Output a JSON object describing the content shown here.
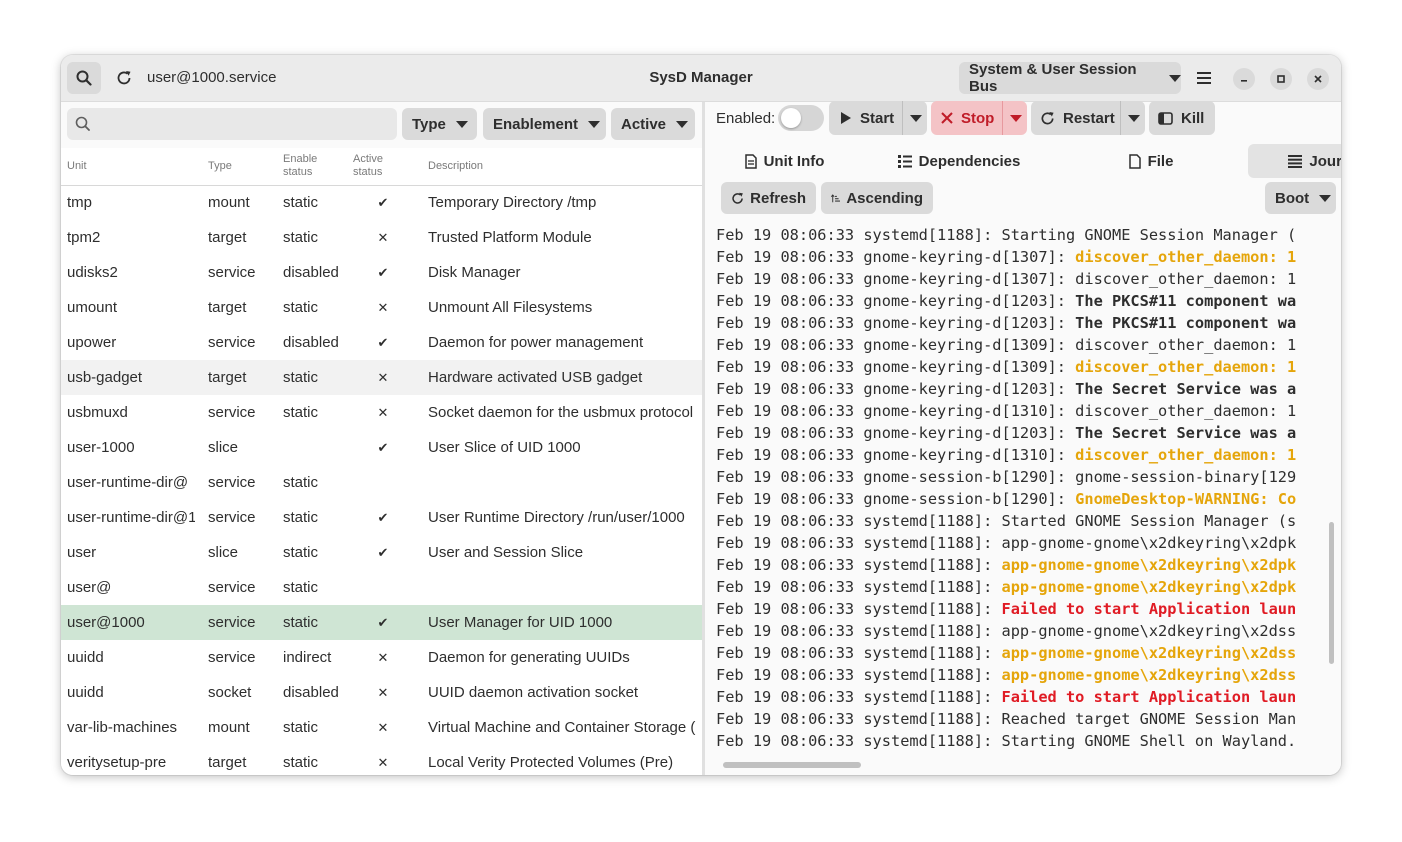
{
  "header": {
    "current_unit": "user@1000.service",
    "title": "SysD Manager",
    "bus_selector": "System & User Session Bus"
  },
  "filters": {
    "search_placeholder": "",
    "type_label": "Type",
    "enablement_label": "Enablement",
    "active_label": "Active"
  },
  "columns": {
    "unit": "Unit",
    "type": "Type",
    "enable_1": "Enable",
    "enable_2": "status",
    "active_1": "Active",
    "active_2": "status",
    "description": "Description"
  },
  "units": [
    {
      "unit": "tmp",
      "type": "mount",
      "enable": "static",
      "active": "✔",
      "desc": "Temporary Directory /tmp"
    },
    {
      "unit": "tpm2",
      "type": "target",
      "enable": "static",
      "active": "✕",
      "desc": "Trusted Platform Module"
    },
    {
      "unit": "udisks2",
      "type": "service",
      "enable": "disabled",
      "active": "✔",
      "desc": "Disk Manager"
    },
    {
      "unit": "umount",
      "type": "target",
      "enable": "static",
      "active": "✕",
      "desc": "Unmount All Filesystems"
    },
    {
      "unit": "upower",
      "type": "service",
      "enable": "disabled",
      "active": "✔",
      "desc": "Daemon for power management"
    },
    {
      "unit": "usb-gadget",
      "type": "target",
      "enable": "static",
      "active": "✕",
      "desc": "Hardware activated USB gadget"
    },
    {
      "unit": "usbmuxd",
      "type": "service",
      "enable": "static",
      "active": "✕",
      "desc": "Socket daemon for the usbmux protocol u"
    },
    {
      "unit": "user-1000",
      "type": "slice",
      "enable": "",
      "active": "✔",
      "desc": "User Slice of UID 1000"
    },
    {
      "unit": "user-runtime-dir@",
      "type": "service",
      "enable": "static",
      "active": "",
      "desc": ""
    },
    {
      "unit": "user-runtime-dir@1",
      "type": "service",
      "enable": "static",
      "active": "✔",
      "desc": "User Runtime Directory /run/user/1000"
    },
    {
      "unit": "user",
      "type": "slice",
      "enable": "static",
      "active": "✔",
      "desc": "User and Session Slice"
    },
    {
      "unit": "user@",
      "type": "service",
      "enable": "static",
      "active": "",
      "desc": ""
    },
    {
      "unit": "user@1000",
      "type": "service",
      "enable": "static",
      "active": "✔",
      "desc": "User Manager for UID 1000"
    },
    {
      "unit": "uuidd",
      "type": "service",
      "enable": "indirect",
      "active": "✕",
      "desc": "Daemon for generating UUIDs"
    },
    {
      "unit": "uuidd",
      "type": "socket",
      "enable": "disabled",
      "active": "✕",
      "desc": "UUID daemon activation socket"
    },
    {
      "unit": "var-lib-machines",
      "type": "mount",
      "enable": "static",
      "active": "✕",
      "desc": "Virtual Machine and Container Storage (C"
    },
    {
      "unit": "veritysetup-pre",
      "type": "target",
      "enable": "static",
      "active": "✕",
      "desc": "Local Verity Protected Volumes (Pre)"
    }
  ],
  "toolbar": {
    "enabled_label": "Enabled:",
    "start": "Start",
    "stop": "Stop",
    "restart": "Restart",
    "kill": "Kill"
  },
  "tabs": {
    "unit_info": "Unit Info",
    "dependencies": "Dependencies",
    "file": "File",
    "journal": "Journal"
  },
  "journal_bar": {
    "refresh": "Refresh",
    "ascending": "Ascending",
    "boot": "Boot"
  },
  "journal": [
    {
      "prefix": "Feb 19 08:06:33 systemd[1188]: ",
      "msg": "Starting GNOME Session Manager (",
      "style": "n"
    },
    {
      "prefix": "Feb 19 08:06:33 gnome-keyring-d[1307]: ",
      "msg": "discover_other_daemon: 1",
      "style": "w"
    },
    {
      "prefix": "Feb 19 08:06:33 gnome-keyring-d[1307]: ",
      "msg": "discover_other_daemon: 1",
      "style": "n"
    },
    {
      "prefix": "Feb 19 08:06:33 gnome-keyring-d[1203]: ",
      "msg": "The PKCS#11 component wa",
      "style": "b"
    },
    {
      "prefix": "Feb 19 08:06:33 gnome-keyring-d[1203]: ",
      "msg": "The PKCS#11 component wa",
      "style": "b"
    },
    {
      "prefix": "Feb 19 08:06:33 gnome-keyring-d[1309]: ",
      "msg": "discover_other_daemon: 1",
      "style": "n"
    },
    {
      "prefix": "Feb 19 08:06:33 gnome-keyring-d[1309]: ",
      "msg": "discover_other_daemon: 1",
      "style": "w"
    },
    {
      "prefix": "Feb 19 08:06:33 gnome-keyring-d[1203]: ",
      "msg": "The Secret Service was a",
      "style": "b"
    },
    {
      "prefix": "Feb 19 08:06:33 gnome-keyring-d[1310]: ",
      "msg": "discover_other_daemon: 1",
      "style": "n"
    },
    {
      "prefix": "Feb 19 08:06:33 gnome-keyring-d[1203]: ",
      "msg": "The Secret Service was a",
      "style": "b"
    },
    {
      "prefix": "Feb 19 08:06:33 gnome-keyring-d[1310]: ",
      "msg": "discover_other_daemon: 1",
      "style": "w"
    },
    {
      "prefix": "Feb 19 08:06:33 gnome-session-b[1290]: ",
      "msg": "gnome-session-binary[129",
      "style": "n"
    },
    {
      "prefix": "Feb 19 08:06:33 gnome-session-b[1290]: ",
      "msg": "GnomeDesktop-WARNING: Co",
      "style": "w"
    },
    {
      "prefix": "Feb 19 08:06:33 systemd[1188]: ",
      "msg": "Started GNOME Session Manager (s",
      "style": "n"
    },
    {
      "prefix": "Feb 19 08:06:33 systemd[1188]: ",
      "msg": "app-gnome-gnome\\x2dkeyring\\x2dpk",
      "style": "n"
    },
    {
      "prefix": "Feb 19 08:06:33 systemd[1188]: ",
      "msg": "app-gnome-gnome\\x2dkeyring\\x2dpk",
      "style": "w"
    },
    {
      "prefix": "Feb 19 08:06:33 systemd[1188]: ",
      "msg": "app-gnome-gnome\\x2dkeyring\\x2dpk",
      "style": "w"
    },
    {
      "prefix": "Feb 19 08:06:33 systemd[1188]: ",
      "msg": "Failed to start Application laun",
      "style": "e"
    },
    {
      "prefix": "Feb 19 08:06:33 systemd[1188]: ",
      "msg": "app-gnome-gnome\\x2dkeyring\\x2dss",
      "style": "n"
    },
    {
      "prefix": "Feb 19 08:06:33 systemd[1188]: ",
      "msg": "app-gnome-gnome\\x2dkeyring\\x2dss",
      "style": "w"
    },
    {
      "prefix": "Feb 19 08:06:33 systemd[1188]: ",
      "msg": "app-gnome-gnome\\x2dkeyring\\x2dss",
      "style": "w"
    },
    {
      "prefix": "Feb 19 08:06:33 systemd[1188]: ",
      "msg": "Failed to start Application laun",
      "style": "e"
    },
    {
      "prefix": "Feb 19 08:06:33 systemd[1188]: ",
      "msg": "Reached target GNOME Session Man",
      "style": "n"
    },
    {
      "prefix": "Feb 19 08:06:33 systemd[1188]: ",
      "msg": "Starting GNOME Shell on Wayland.",
      "style": "n"
    }
  ],
  "colors": {
    "selected_row": "#cfe5d4",
    "warning_text": "#e5a50a",
    "error_text": "#e01b24",
    "stop_button_bg": "#f4c3c6",
    "stop_button_fg": "#c01c28"
  },
  "icons": {
    "search": "search-icon",
    "refresh": "refresh-icon",
    "menu": "hamburger-menu-icon",
    "minimize": "minimize-icon",
    "maximize": "maximize-icon",
    "close": "close-icon",
    "start": "play-icon",
    "stop": "x-icon",
    "restart": "restart-icon",
    "kill": "kill-icon",
    "unit_info": "document-icon",
    "dependencies": "list-icon",
    "file": "file-icon",
    "journal": "lines-icon",
    "ascending": "sort-ascending-icon"
  }
}
